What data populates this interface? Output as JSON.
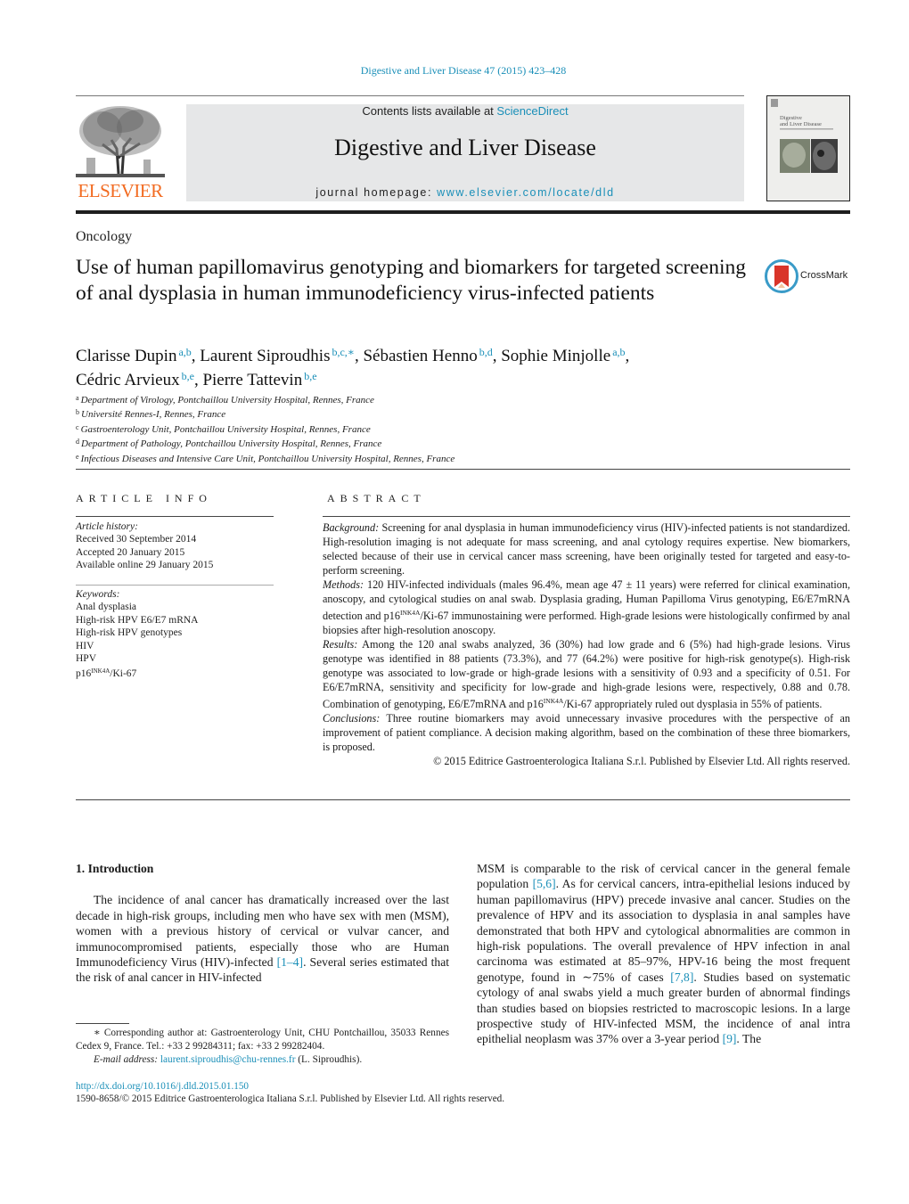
{
  "header": {
    "running_head": "Digestive and Liver Disease 47 (2015) 423–428",
    "publisher_logo_text": "ELSEVIER",
    "contents_prefix": "Contents lists available at ",
    "contents_link": "ScienceDirect",
    "journal_title": "Digestive and Liver Disease",
    "homepage_prefix": "journal homepage: ",
    "homepage_link": "www.elsevier.com/locate/dld",
    "cover_title_line1": "Digestive",
    "cover_title_line2": "and Liver Disease"
  },
  "article": {
    "section": "Oncology",
    "title": "Use of human papillomavirus genotyping and biomarkers for targeted screening of anal dysplasia in human immunodeficiency virus-infected patients",
    "crossmark_label": "CrossMark",
    "authors": [
      {
        "name": "Clarisse Dupin",
        "sup": "a,b",
        "sep": ", "
      },
      {
        "name": "Laurent Siproudhis",
        "sup": "b,c,∗",
        "sep": ", "
      },
      {
        "name": "Sébastien Henno",
        "sup": "b,d",
        "sep": ", "
      },
      {
        "name": "Sophie Minjolle",
        "sup": "a,b",
        "sep": ","
      },
      {
        "name": "Cédric Arvieux",
        "sup": "b,e",
        "sep": ", "
      },
      {
        "name": "Pierre Tattevin",
        "sup": "b,e",
        "sep": ""
      }
    ],
    "affiliations": [
      {
        "key": "a",
        "text": "Department of Virology, Pontchaillou University Hospital, Rennes, France"
      },
      {
        "key": "b",
        "text": "Université Rennes-I, Rennes, France"
      },
      {
        "key": "c",
        "text": "Gastroenterology Unit, Pontchaillou University Hospital, Rennes, France"
      },
      {
        "key": "d",
        "text": "Department of Pathology, Pontchaillou University Hospital, Rennes, France"
      },
      {
        "key": "e",
        "text": "Infectious Diseases and Intensive Care Unit, Pontchaillou University Hospital, Rennes, France"
      }
    ]
  },
  "article_info": {
    "heading": "ARTICLE INFO",
    "history_label": "Article history:",
    "received": "Received 30 September 2014",
    "accepted": "Accepted 20 January 2015",
    "online": "Available online 29 January 2015",
    "keywords_label": "Keywords:",
    "keywords": [
      "Anal dysplasia",
      "High-risk HPV E6/E7 mRNA",
      "High-risk HPV genotypes",
      "HIV",
      "HPV"
    ],
    "keyword_last_prefix": "p16",
    "keyword_last_sup": "INK4A",
    "keyword_last_suffix": "/Ki-67"
  },
  "abstract": {
    "heading": "ABSTRACT",
    "background_label": "Background:",
    "background": " Screening for anal dysplasia in human immunodeficiency virus (HIV)-infected patients is not standardized. High-resolution imaging is not adequate for mass screening, and anal cytology requires expertise. New biomarkers, selected because of their use in cervical cancer mass screening, have been originally tested for targeted and easy-to-perform screening.",
    "methods_label": "Methods:",
    "methods_a": " 120 HIV-infected individuals (males 96.4%, mean age 47 ± 11 years) were referred for clinical examination, anoscopy, and cytological studies on anal swab. Dysplasia grading, Human Papilloma Virus genotyping, E6/E7mRNA detection and p16",
    "methods_sup": "INK4A",
    "methods_b": "/Ki-67 immunostaining were performed. High-grade lesions were histologically confirmed by anal biopsies after high-resolution anoscopy.",
    "results_label": "Results:",
    "results_a": " Among the 120 anal swabs analyzed, 36 (30%) had low grade and 6 (5%) had high-grade lesions. Virus genotype was identified in 88 patients (73.3%), and 77 (64.2%) were positive for high-risk genotype(s). High-risk genotype was associated to low-grade or high-grade lesions with a sensitivity of 0.93 and a specificity of 0.51. For E6/E7mRNA, sensitivity and specificity for low-grade and high-grade lesions were, respectively, 0.88 and 0.78. Combination of genotyping, E6/E7mRNA and p16",
    "results_sup": "INK4A",
    "results_b": "/Ki-67 appropriately ruled out dysplasia in 55% of patients.",
    "conclusions_label": "Conclusions:",
    "conclusions": " Three routine biomarkers may avoid unnecessary invasive procedures with the perspective of an improvement of patient compliance. A decision making algorithm, based on the combination of these three biomarkers, is proposed.",
    "copyright": "© 2015 Editrice Gastroenterologica Italiana S.r.l. Published by Elsevier Ltd. All rights reserved."
  },
  "body": {
    "intro_heading": "1.  Introduction",
    "left_a": "The incidence of anal cancer has dramatically increased over the last decade in high-risk groups, including men who have sex with men (MSM), women with a previous history of cervical or vulvar cancer, and immunocompromised patients, especially those who are Human Immunodeficiency Virus (HIV)-infected ",
    "left_ref1": "[1–4]",
    "left_b": ". Several series estimated that the risk of anal cancer in HIV-infected",
    "right_a": "MSM is comparable to the risk of cervical cancer in the general female population ",
    "right_ref1": "[5,6]",
    "right_b": ". As for cervical cancers, intra-epithelial lesions induced by human papillomavirus (HPV) precede invasive anal cancer. Studies on the prevalence of HPV and its association to dysplasia in anal samples have demonstrated that both HPV and cytological abnormalities are common in high-risk populations. The overall prevalence of HPV infection in anal carcinoma was estimated at 85–97%, HPV-16 being the most frequent genotype, found in ∼75% of cases ",
    "right_ref2": "[7,8]",
    "right_c": ". Studies based on systematic cytology of anal swabs yield a much greater burden of abnormal findings than studies based on biopsies restricted to macroscopic lesions. In a large prospective study of HIV-infected MSM, the incidence of anal intra epithelial neoplasm was 37% over a 3-year period ",
    "right_ref3": "[9]",
    "right_d": ". The"
  },
  "footnote": {
    "corresponding": "∗  Corresponding author at: Gastroenterology Unit, CHU Pontchaillou, 35033 Rennes Cedex 9, France. Tel.: +33 2 99284311; fax: +33 2 99282404.",
    "email_label": "E-mail address:",
    "email": "laurent.siproudhis@chu-rennes.fr",
    "email_suffix": " (L. Siproudhis)."
  },
  "doi": {
    "link": "http://dx.doi.org/10.1016/j.dld.2015.01.150",
    "issn_line": "1590-8658/© 2015 Editrice Gastroenterologica Italiana S.r.l. Published by Elsevier Ltd. All rights reserved."
  }
}
